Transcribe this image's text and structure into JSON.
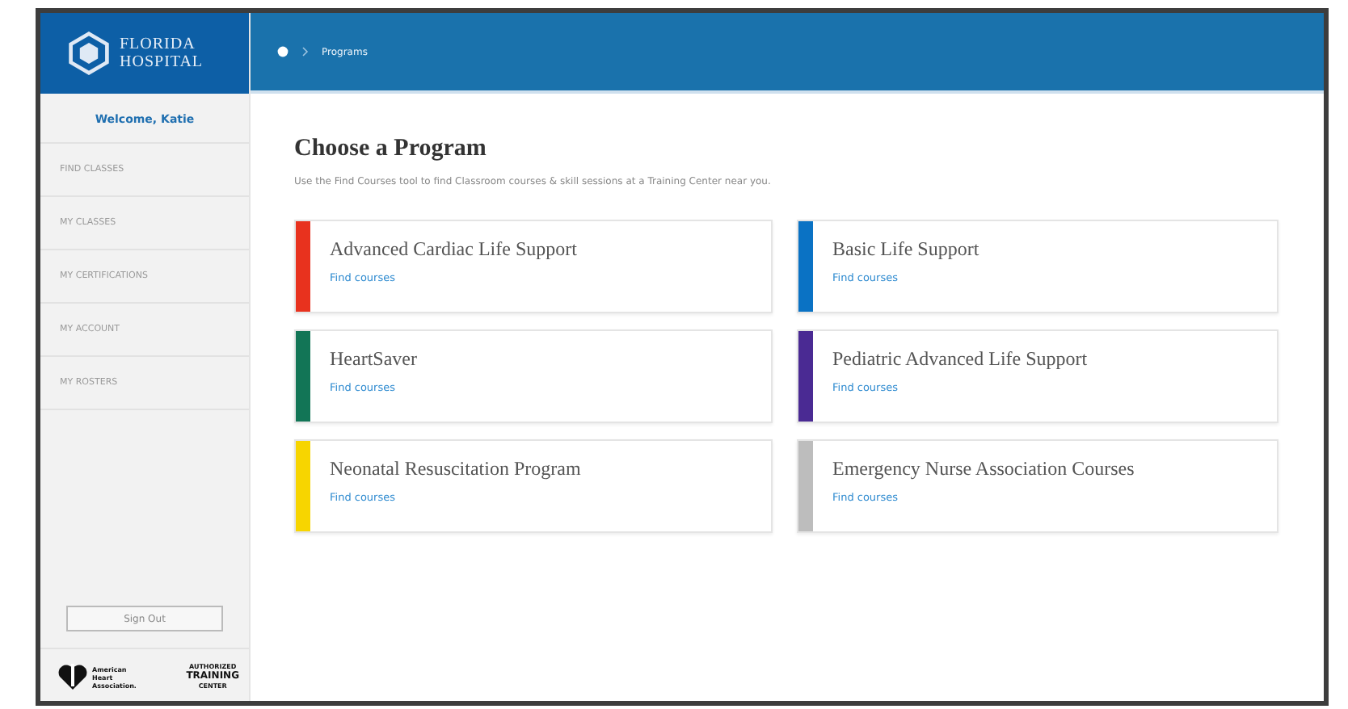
{
  "header": {
    "logo_text": [
      "FLORIDA",
      "HOSPITAL"
    ],
    "breadcrumb": [
      {
        "kind": "home"
      },
      {
        "kind": "text",
        "label": "Programs"
      }
    ]
  },
  "sidebar": {
    "welcome": "Welcome, Katie",
    "items": [
      {
        "label": "FIND CLASSES"
      },
      {
        "label": "MY CLASSES"
      },
      {
        "label": "MY CERTIFICATIONS"
      },
      {
        "label": "MY ACCOUNT"
      },
      {
        "label": "MY ROSTERS"
      }
    ],
    "sign_out": "Sign Out",
    "footer": {
      "aha_text": [
        "American",
        "Heart",
        "Association."
      ],
      "badge_text": [
        "AUTHORIZED",
        "TRAINING",
        "CENTER"
      ]
    }
  },
  "main": {
    "title": "Choose a Program",
    "subtitle": "Use the Find Courses tool to find Classroom courses & skill sessions at a Training Center near you.",
    "programs": [
      {
        "name": "Advanced Cardiac Life Support",
        "link": "Find courses",
        "color": "#e8321e"
      },
      {
        "name": "Basic Life Support",
        "link": "Find courses",
        "color": "#0a72c4"
      },
      {
        "name": "HeartSaver",
        "link": "Find courses",
        "color": "#127556"
      },
      {
        "name": "Pediatric Advanced Life Support",
        "link": "Find courses",
        "color": "#4a2a93"
      },
      {
        "name": "Neonatal Resuscitation Program",
        "link": "Find courses",
        "color": "#f7d500"
      },
      {
        "name": "Emergency Nurse Association Courses",
        "link": "Find courses",
        "color": "#bdbdbd"
      }
    ]
  }
}
